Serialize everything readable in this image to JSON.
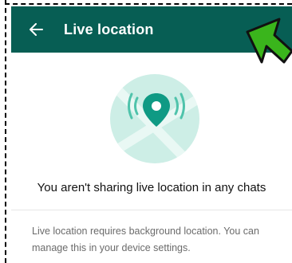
{
  "app_bar": {
    "title": "Live location",
    "back_icon": "back-arrow-icon",
    "background": "#075e54"
  },
  "illustration": {
    "icon": "live-location-pin-icon",
    "circle_color": "#cdeee6",
    "pin_color": "#0f9a84"
  },
  "empty_state": {
    "message": "You aren't sharing live location in any chats"
  },
  "info": {
    "text": "Live location requires background location. You can manage this in your device settings."
  },
  "annotation": {
    "icon": "pointer-arrow-icon",
    "color": "#3ab51c"
  }
}
